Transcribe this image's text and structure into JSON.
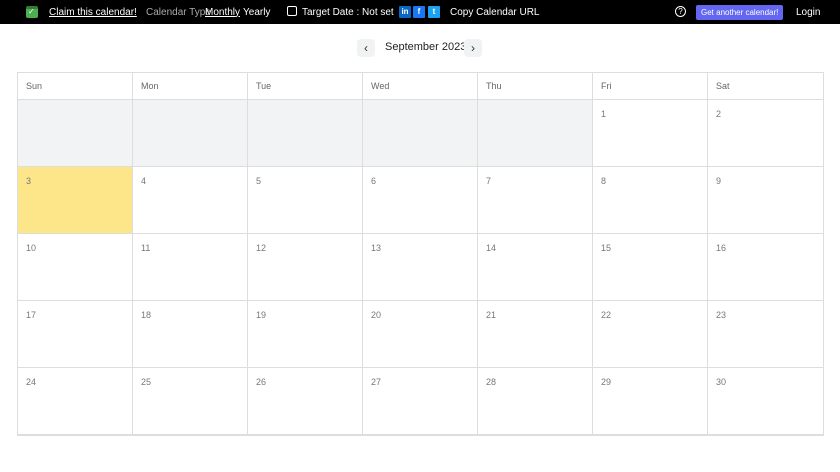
{
  "topbar": {
    "claim": "Claim this calendar!",
    "calendar_type_label": "Calendar Type",
    "monthly": "Monthly",
    "yearly": "Yearly",
    "target_date": "Target Date : Not set",
    "linkedin": "in",
    "facebook": "f",
    "twitter": "t",
    "copy_url": "Copy Calendar URL",
    "help": "?",
    "get_another": "Get another calendar!",
    "login": "Login"
  },
  "calendar": {
    "month_label": "September 2023",
    "prev": "‹",
    "next": "›",
    "weekdays": [
      "Sun",
      "Mon",
      "Tue",
      "Wed",
      "Thu",
      "Fri",
      "Sat"
    ],
    "leading_empty": 5,
    "days": 30,
    "today": 3
  },
  "colors": {
    "accent": "#6366f1",
    "today": "#fde68a"
  }
}
